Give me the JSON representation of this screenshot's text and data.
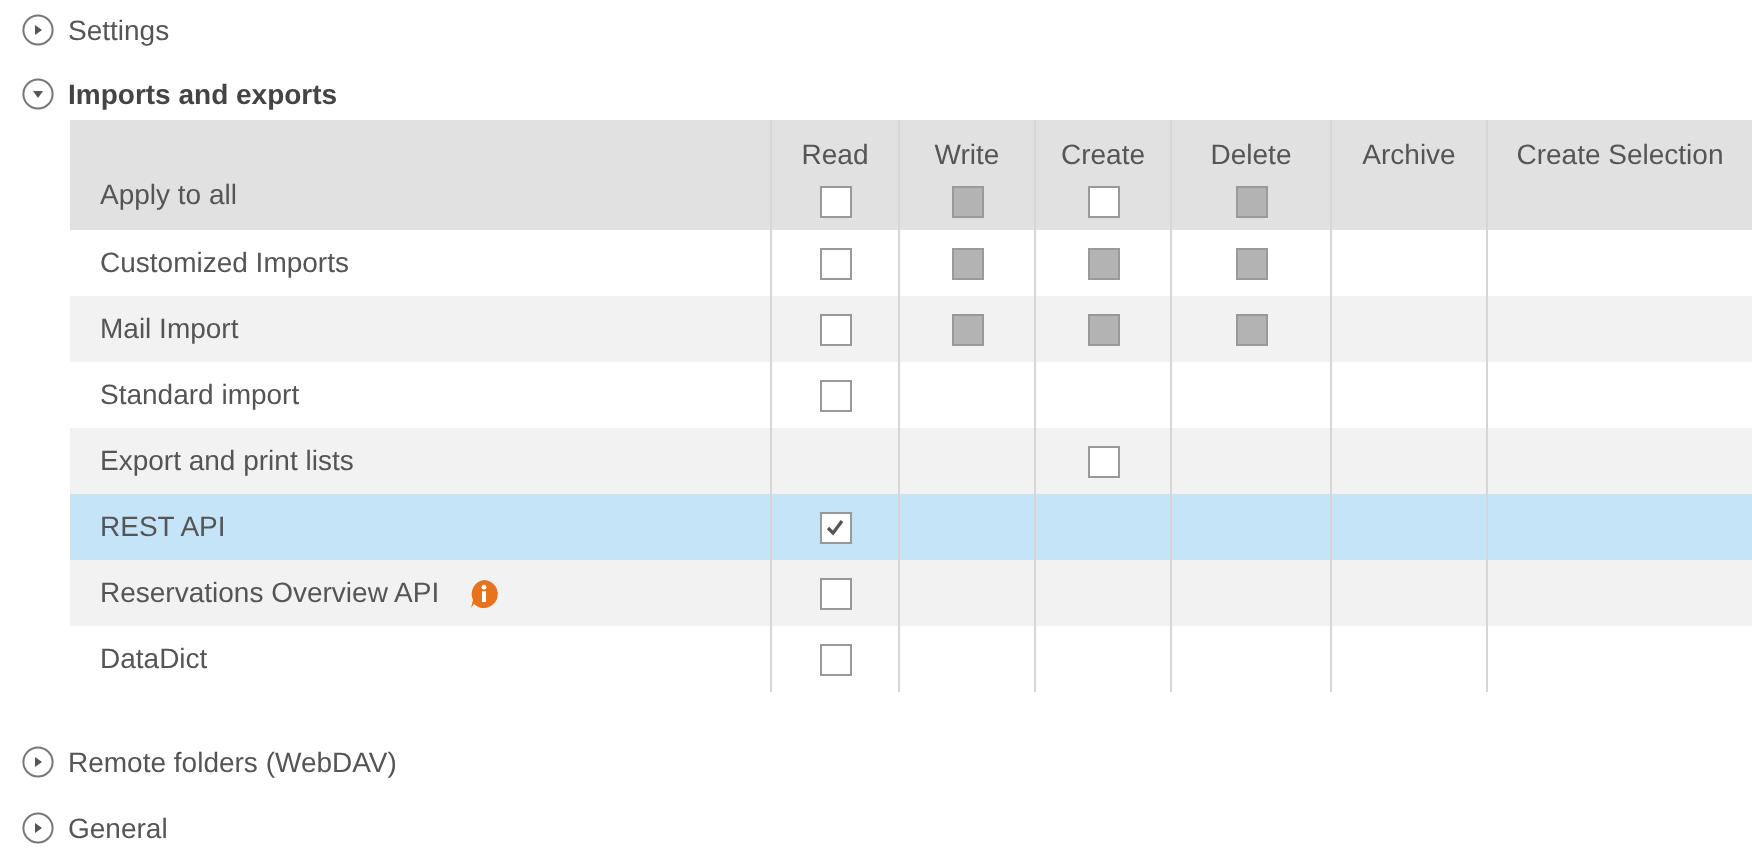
{
  "sections": [
    {
      "title": "Settings",
      "expanded": false
    },
    {
      "title": "Imports and exports",
      "expanded": true,
      "table": {
        "columns": [
          "Read",
          "Write",
          "Create",
          "Delete",
          "Archive",
          "Create Selection"
        ],
        "apply_all": {
          "label": "Apply to all",
          "cells": [
            {
              "kind": "checkbox",
              "checked": false,
              "disabled": false
            },
            {
              "kind": "checkbox",
              "checked": false,
              "disabled": true
            },
            {
              "kind": "checkbox",
              "checked": false,
              "disabled": false
            },
            {
              "kind": "checkbox",
              "checked": false,
              "disabled": true
            },
            {
              "kind": "empty"
            },
            {
              "kind": "empty"
            }
          ]
        },
        "rows": [
          {
            "label": "Customized Imports",
            "selected": false,
            "info": false,
            "cells": [
              {
                "kind": "checkbox",
                "checked": false,
                "disabled": false
              },
              {
                "kind": "checkbox",
                "checked": false,
                "disabled": true
              },
              {
                "kind": "checkbox",
                "checked": false,
                "disabled": true
              },
              {
                "kind": "checkbox",
                "checked": false,
                "disabled": true
              },
              {
                "kind": "empty"
              },
              {
                "kind": "empty"
              }
            ]
          },
          {
            "label": "Mail Import",
            "selected": false,
            "info": false,
            "cells": [
              {
                "kind": "checkbox",
                "checked": false,
                "disabled": false
              },
              {
                "kind": "checkbox",
                "checked": false,
                "disabled": true
              },
              {
                "kind": "checkbox",
                "checked": false,
                "disabled": true
              },
              {
                "kind": "checkbox",
                "checked": false,
                "disabled": true
              },
              {
                "kind": "empty"
              },
              {
                "kind": "empty"
              }
            ]
          },
          {
            "label": "Standard import",
            "selected": false,
            "info": false,
            "cells": [
              {
                "kind": "checkbox",
                "checked": false,
                "disabled": false
              },
              {
                "kind": "empty"
              },
              {
                "kind": "empty"
              },
              {
                "kind": "empty"
              },
              {
                "kind": "empty"
              },
              {
                "kind": "empty"
              }
            ]
          },
          {
            "label": "Export and print lists",
            "selected": false,
            "info": false,
            "cells": [
              {
                "kind": "empty"
              },
              {
                "kind": "empty"
              },
              {
                "kind": "checkbox",
                "checked": false,
                "disabled": false
              },
              {
                "kind": "empty"
              },
              {
                "kind": "empty"
              },
              {
                "kind": "empty"
              }
            ]
          },
          {
            "label": "REST API",
            "selected": true,
            "info": false,
            "cells": [
              {
                "kind": "checkbox",
                "checked": true,
                "disabled": false
              },
              {
                "kind": "empty"
              },
              {
                "kind": "empty"
              },
              {
                "kind": "empty"
              },
              {
                "kind": "empty"
              },
              {
                "kind": "empty"
              }
            ]
          },
          {
            "label": "Reservations Overview API",
            "selected": false,
            "info": true,
            "cells": [
              {
                "kind": "checkbox",
                "checked": false,
                "disabled": false
              },
              {
                "kind": "empty"
              },
              {
                "kind": "empty"
              },
              {
                "kind": "empty"
              },
              {
                "kind": "empty"
              },
              {
                "kind": "empty"
              }
            ]
          },
          {
            "label": "DataDict",
            "selected": false,
            "info": false,
            "cells": [
              {
                "kind": "checkbox",
                "checked": false,
                "disabled": false
              },
              {
                "kind": "empty"
              },
              {
                "kind": "empty"
              },
              {
                "kind": "empty"
              },
              {
                "kind": "empty"
              },
              {
                "kind": "empty"
              }
            ]
          }
        ]
      }
    },
    {
      "title": "Remote folders (WebDAV)",
      "expanded": false
    },
    {
      "title": "General",
      "expanded": false
    }
  ]
}
